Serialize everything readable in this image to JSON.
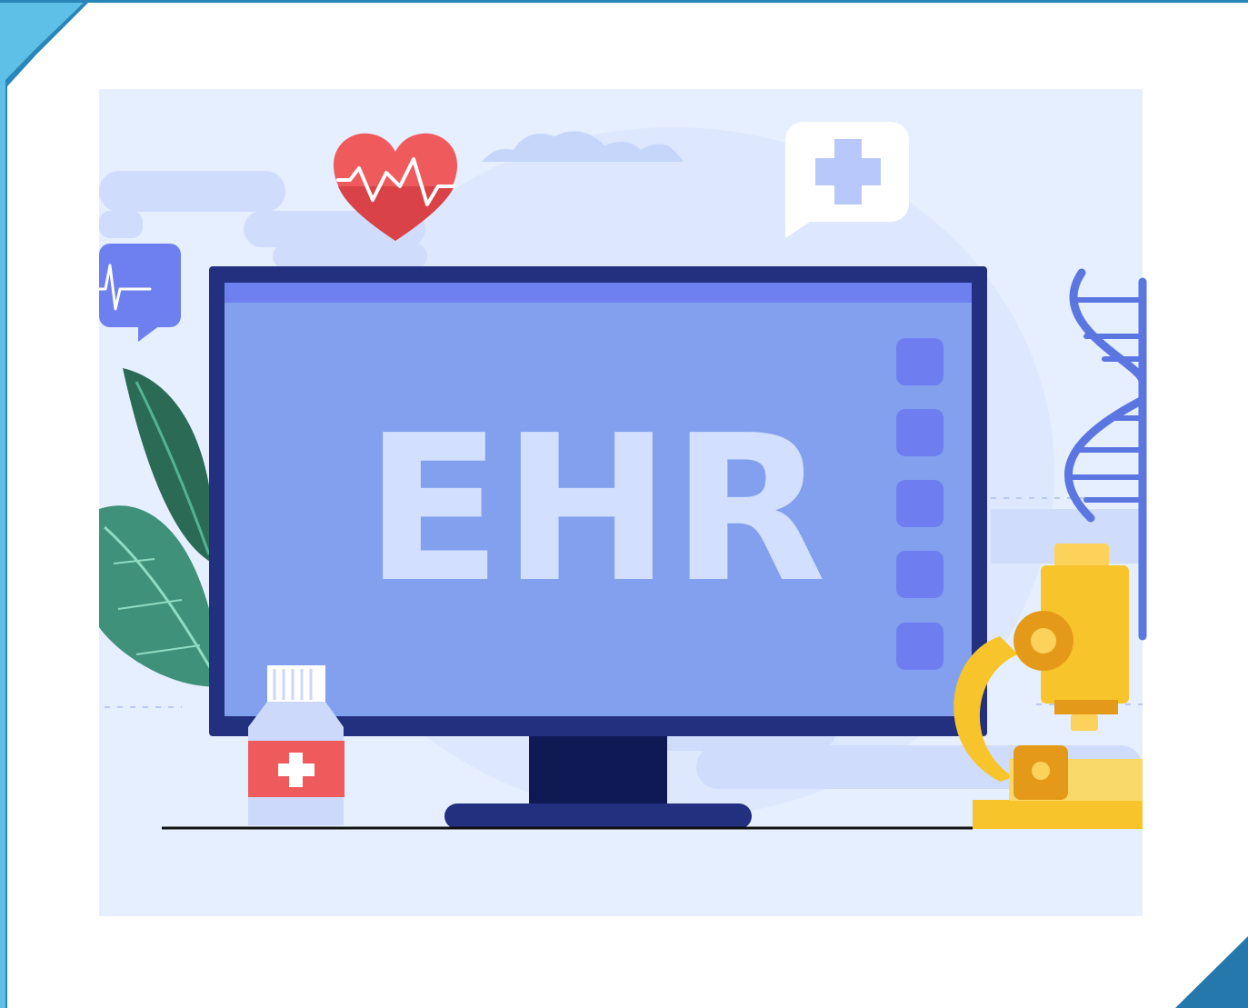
{
  "illustration": {
    "screen_text": "EHR"
  },
  "colors": {
    "frame_accent": "#2a86b8",
    "frame_accent_light": "#5ec0e6",
    "scene_background": "#e6efff",
    "monitor_bezel": "#22307f",
    "monitor_screen": "#82a0ee",
    "monitor_screen_header": "#6e80ef",
    "screen_text": "#d2dfff",
    "heart": "#ef5a5d",
    "leaf_dark": "#2b6b55",
    "leaf_light": "#3f917a",
    "microscope": "#f7c52b",
    "microscope_dark": "#e49a18",
    "dna": "#5b76e0",
    "medicine_label": "#ef5a5d"
  },
  "icons": [
    "heart-rate-icon",
    "medical-chat-bubble-icon",
    "pulse-chat-bubble-icon",
    "dna-helix-icon",
    "microscope-icon",
    "medicine-bottle-icon",
    "leaf-icon",
    "monitor-icon"
  ]
}
